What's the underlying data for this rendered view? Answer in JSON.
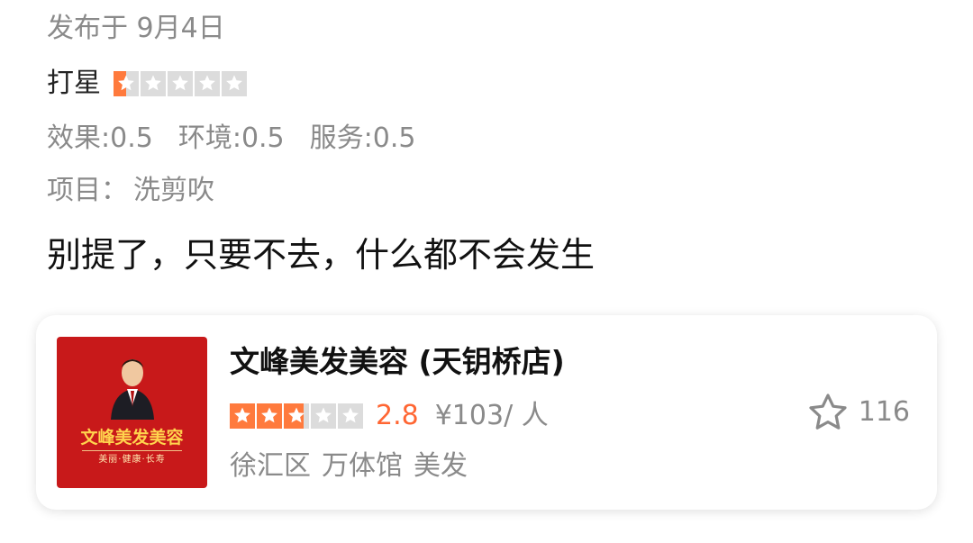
{
  "post": {
    "date_text": "发布于 9月4日",
    "rating_label": "打星",
    "rating_value": 0.5,
    "rating_max": 5,
    "scores": [
      {
        "label": "效果",
        "value": "0.5"
      },
      {
        "label": "环境",
        "value": "0.5"
      },
      {
        "label": "服务",
        "value": "0.5"
      }
    ],
    "project_label": "项目：",
    "project_value": "洗剪吹",
    "review_text": "别提了，只要不去，什么都不会发生"
  },
  "shop": {
    "name": "文峰美发美容 (天钥桥店)",
    "logo_brand_text": "文峰美发美容",
    "logo_slogan": "美丽·健康·长寿",
    "rating_value": 2.8,
    "rating_max": 5,
    "score_text": "2.8",
    "price_text": "¥103/ 人",
    "district": "徐汇区",
    "area": "万体馆",
    "category": "美发",
    "favorites_count": "116",
    "favorite_icon": "star-outline-icon"
  },
  "colors": {
    "star_active": "#ff7a3d",
    "star_inactive": "#dcdcdc",
    "accent_score": "#ff6633",
    "logo_bg": "#c8191a",
    "secondary_text": "#8a8a8a"
  }
}
